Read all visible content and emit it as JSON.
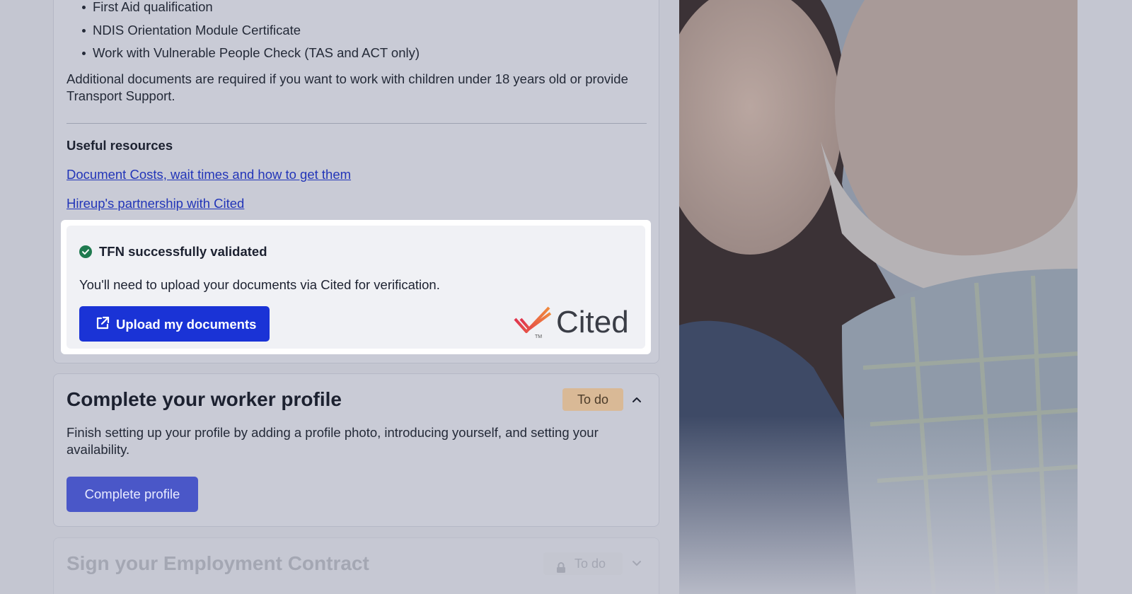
{
  "requirements": {
    "bullets": [
      "First Aid qualification",
      "NDIS Orientation Module Certificate",
      "Work with Vulnerable People Check (TAS and ACT only)"
    ],
    "additional_note": "Additional documents are required if you want to work with children under 18 years old or provide Transport Support."
  },
  "resources": {
    "heading": "Useful resources",
    "links": [
      "Document Costs, wait times and how to get them",
      "Hireup's partnership with Cited"
    ]
  },
  "tfn": {
    "status": "TFN successfully validated",
    "message": "You'll need to upload your documents via Cited for verification.",
    "upload_label": "Upload my documents",
    "partner_logo_text": "Cited",
    "trademark": "TM"
  },
  "profile_step": {
    "title": "Complete your worker profile",
    "badge": "To do",
    "description": "Finish setting up your profile by adding a profile photo, introducing yourself, and setting your availability.",
    "button_label": "Complete profile"
  },
  "contract_step": {
    "title": "Sign your Employment Contract",
    "badge": "To do"
  },
  "colors": {
    "primary": "#1a33d6",
    "success": "#1f7a4f",
    "todo_badge": "#d9b996",
    "link": "#2235b8"
  }
}
